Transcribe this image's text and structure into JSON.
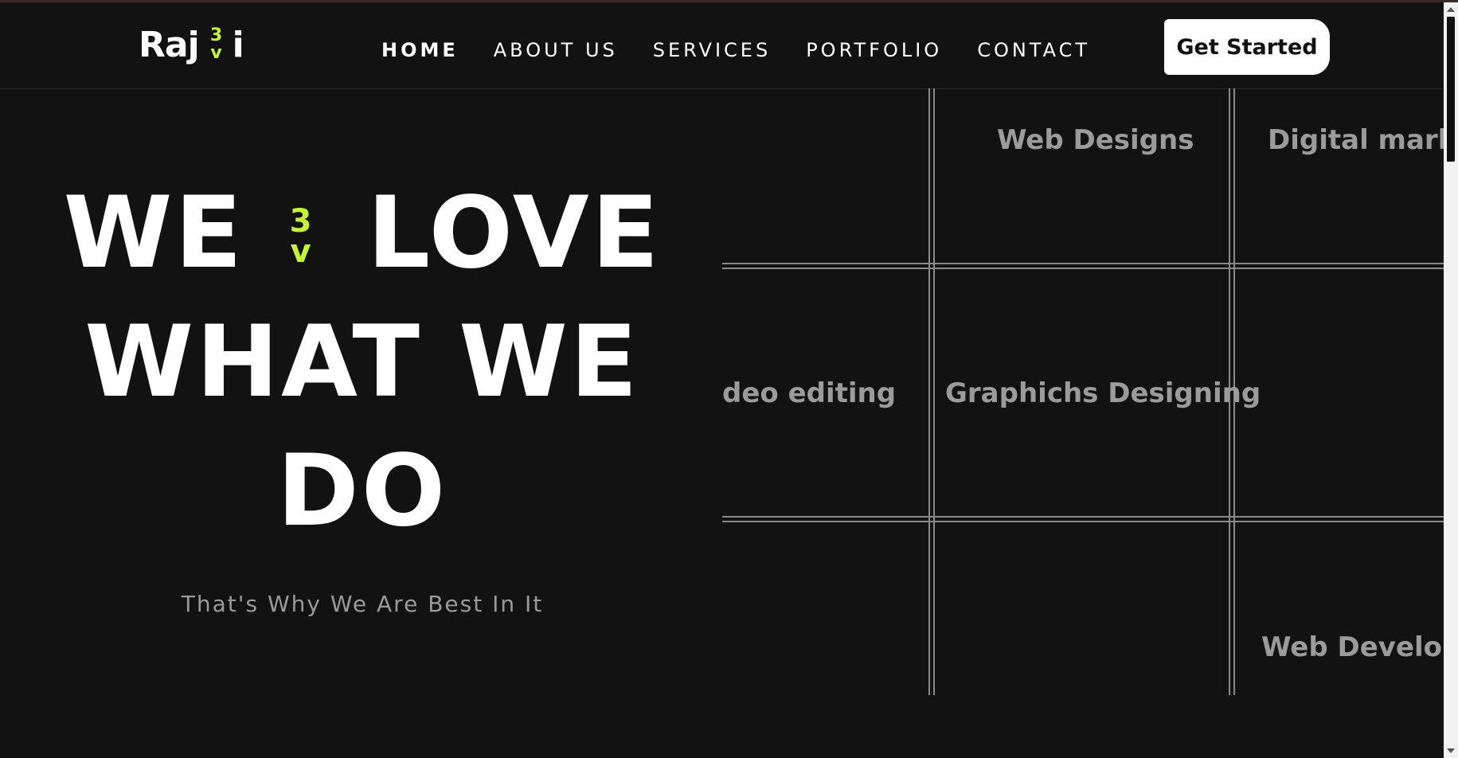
{
  "brand": {
    "name_part1": "Raj",
    "name_part2": "i",
    "accent_color": "#C6F432",
    "mark_icon": "heart-3v-icon"
  },
  "nav": {
    "items": [
      {
        "label": "HOME",
        "active": true
      },
      {
        "label": "ABOUT US",
        "active": false
      },
      {
        "label": "SERVICES",
        "active": false
      },
      {
        "label": "PORTFOLIO",
        "active": false
      },
      {
        "label": "CONTACT",
        "active": false
      }
    ],
    "cta_label": "Get Started"
  },
  "hero": {
    "line1_a": "WE",
    "line1_b": "LOVE",
    "line2": "WHAT WE",
    "line3": "DO",
    "subtitle": "That's Why We Are Best In It"
  },
  "services_grid": {
    "cells": [
      "Web Designs",
      "Digital marke",
      "deo editing",
      "Graphichs Designing",
      "Web Develop"
    ]
  },
  "colors": {
    "background": "#121212",
    "text": "#FFFFFF",
    "muted": "#9A9A9A",
    "grid_line": "#8A8A8A"
  }
}
